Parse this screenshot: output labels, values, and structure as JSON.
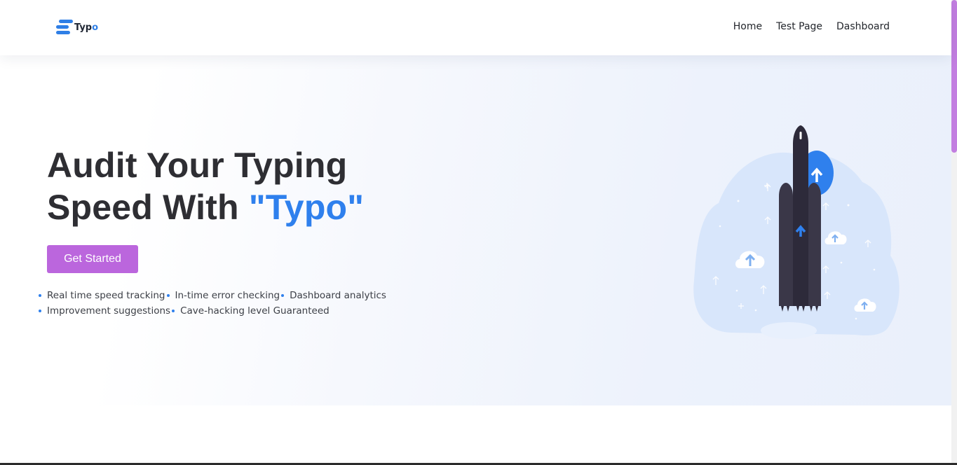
{
  "navbar": {
    "logo_text_main": "Typ",
    "logo_text_accent": "o",
    "links": [
      "Home",
      "Test Page",
      "Dashboard"
    ]
  },
  "hero": {
    "headline_line1": "Audit Your Typing",
    "headline_line2_prefix": "Speed With ",
    "headline_accent": "\"Typo\"",
    "cta_label": "Get Started",
    "features_row1": [
      "Real time speed tracking",
      "In-time error checking",
      "Dashboard analytics"
    ],
    "features_row2": [
      "Improvement suggestions",
      "Cave-hacking level Guaranteed"
    ]
  },
  "colors": {
    "accent_blue": "#2f80ed",
    "cta_purple": "#bb66dd",
    "scroll_thumb": "#c27ee0"
  },
  "icons": [
    "logo-icon",
    "rocket-illustration",
    "upload-cloud-icon",
    "arrow-up-icon"
  ]
}
